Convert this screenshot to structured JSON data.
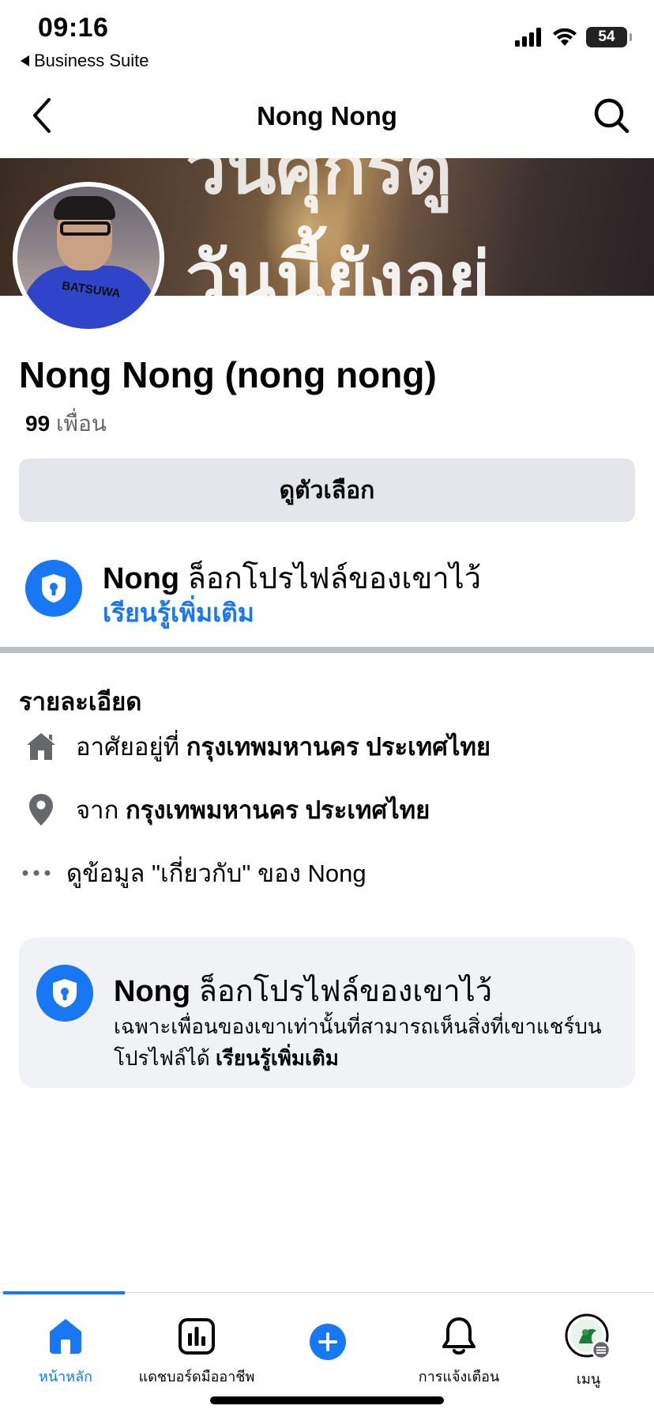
{
  "status_bar": {
    "time": "09:16",
    "back_app": "Business Suite",
    "battery": "54"
  },
  "header": {
    "title": "Nong Nong"
  },
  "cover": {
    "line_top": "วันศุกร์ดู",
    "line_bottom": "วันนี้ยังอยู่"
  },
  "avatar": {
    "shirt_text": "BATSUWA"
  },
  "profile": {
    "name": "Nong Nong (nong nong)",
    "friends_count": "99",
    "friends_label": "เพื่อน",
    "options_label": "ดูตัวเลือก"
  },
  "lock_notice": {
    "name": "Nong",
    "text": "ล็อกโปรไฟล์ของเขาไว้",
    "learn_more": "เรียนรู้เพิ่มเติม"
  },
  "details": {
    "title": "รายละเอียด",
    "lives_prefix": "อาศัยอยู่ที่",
    "lives_city": "กรุงเทพมหานคร ประเทศไทย",
    "from_prefix": "จาก",
    "from_city": "กรุงเทพมหานคร ประเทศไทย",
    "about": "ดูข้อมูล \"เกี่ยวกับ\" ของ Nong"
  },
  "locked_card": {
    "name": "Nong",
    "text": "ล็อกโปรไฟล์ของเขาไว้",
    "description": "เฉพาะเพื่อนของเขาเท่านั้นที่สามารถเห็นสิ่งที่เขาแชร์บนโปรไฟล์ได้",
    "learn_more": "เรียนรู้เพิ่มเติม"
  },
  "tabs": [
    {
      "label": "หน้าหลัก",
      "icon": "home-icon",
      "active": true
    },
    {
      "label": "แดชบอร์ดมืออาชีพ",
      "icon": "dashboard-icon",
      "active": false
    },
    {
      "label": "",
      "icon": "plus-icon",
      "active": false
    },
    {
      "label": "การแจ้งเตือน",
      "icon": "bell-icon",
      "active": false
    },
    {
      "label": "เมนู",
      "icon": "menu-avatar-icon",
      "active": false
    }
  ],
  "colors": {
    "accent": "#1877f2",
    "button_bg": "#e4e6eb",
    "card_bg": "#f0f2f5",
    "secondary_text": "#65676b"
  }
}
